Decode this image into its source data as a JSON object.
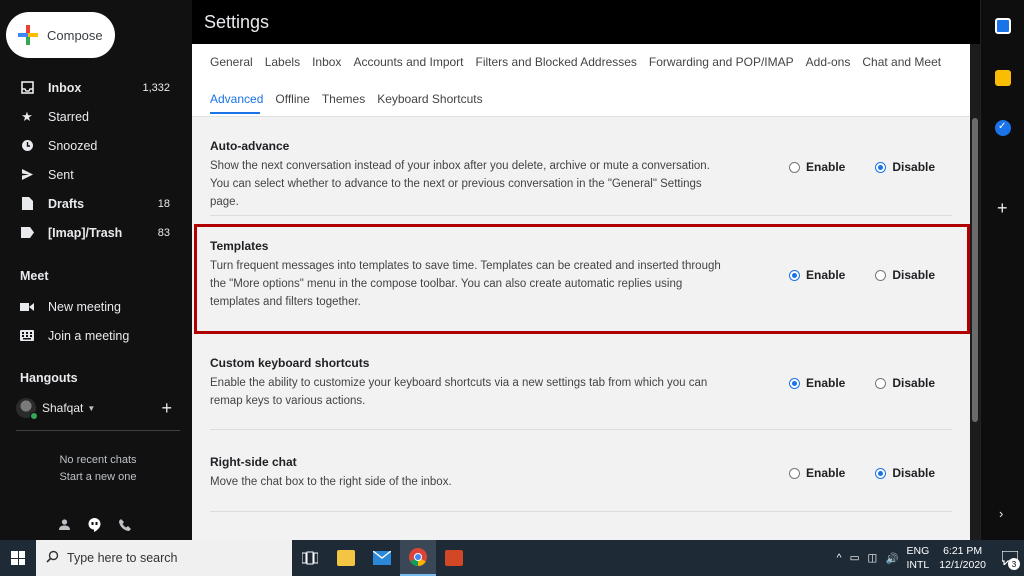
{
  "compose": {
    "label": "Compose"
  },
  "nav": {
    "items": [
      {
        "label": "Inbox",
        "count": "1,332",
        "icon": "inbox-icon",
        "bold": true
      },
      {
        "label": "Starred",
        "count": "",
        "icon": "star-icon",
        "bold": false
      },
      {
        "label": "Snoozed",
        "count": "",
        "icon": "clock-icon",
        "bold": false
      },
      {
        "label": "Sent",
        "count": "",
        "icon": "send-icon",
        "bold": false
      },
      {
        "label": "Drafts",
        "count": "18",
        "icon": "draft-icon",
        "bold": true
      },
      {
        "label": "[Imap]/Trash",
        "count": "83",
        "icon": "label-icon",
        "bold": true
      }
    ]
  },
  "meet": {
    "title": "Meet",
    "new_meeting": "New meeting",
    "join_meeting": "Join a meeting"
  },
  "hangouts": {
    "title": "Hangouts",
    "user": "Shafqat",
    "no_chats": "No recent chats",
    "start_new": "Start a new one"
  },
  "settings": {
    "title": "Settings",
    "tabs_row1": [
      "General",
      "Labels",
      "Inbox",
      "Accounts and Import",
      "Filters and Blocked Addresses",
      "Forwarding and POP/IMAP",
      "Add-ons",
      "Chat and Meet"
    ],
    "tabs_row2": [
      "Advanced",
      "Offline",
      "Themes",
      "Keyboard Shortcuts"
    ],
    "active_tab": "Advanced",
    "enable_label": "Enable",
    "disable_label": "Disable",
    "items": [
      {
        "name": "Auto-advance",
        "desc": "Show the next conversation instead of your inbox after you delete, archive or mute a conversation. You can select whether to advance to the next or previous conversation in the \"General\" Settings page.",
        "selected": "Disable"
      },
      {
        "name": "Templates",
        "desc": "Turn frequent messages into templates to save time. Templates can be created and inserted through the \"More options\" menu in the compose toolbar. You can also create automatic replies using templates and filters together.",
        "selected": "Enable"
      },
      {
        "name": "Custom keyboard shortcuts",
        "desc": "Enable the ability to customize your keyboard shortcuts via a new settings tab from which you can remap keys to various actions.",
        "selected": "Enable"
      },
      {
        "name": "Right-side chat",
        "desc": "Move the chat box to the right side of the inbox.",
        "selected": "Disable"
      }
    ]
  },
  "taskbar": {
    "search_placeholder": "Type here to search",
    "lang_top": "ENG",
    "lang_bottom": "INTL",
    "time": "6:21 PM",
    "date": "12/1/2020",
    "notification_count": "3"
  },
  "colors": {
    "accent": "#1a73e8",
    "highlight_border": "#b00000"
  }
}
